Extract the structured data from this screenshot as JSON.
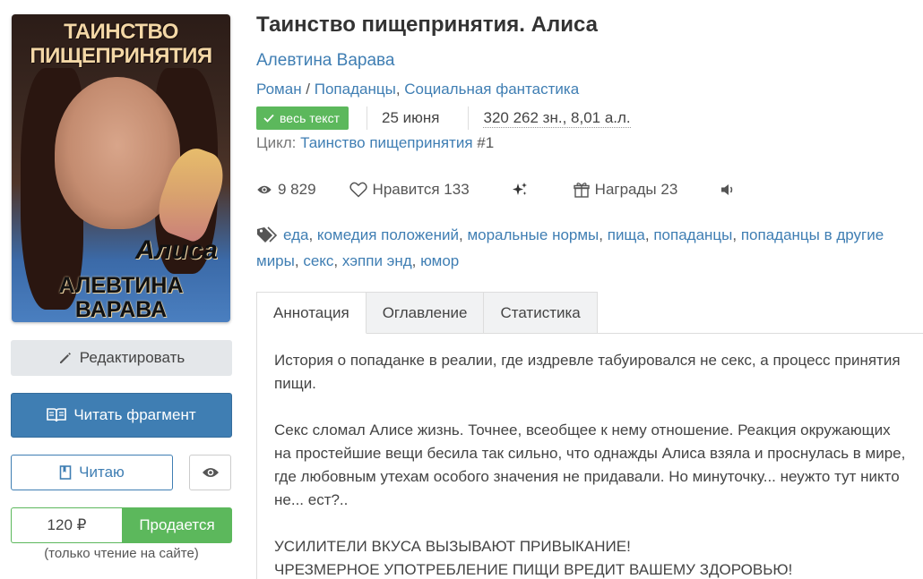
{
  "cover": {
    "title": "ТАИНСТВО ПИЩЕПРИНЯТИЯ",
    "series": "Алиса",
    "author": "АЛЕВТИНА ВАРАВА"
  },
  "actions": {
    "edit_label": "Редактировать",
    "read_fragment_label": "Читать фрагмент",
    "reading_label": "Читаю",
    "price": "120 ₽",
    "sale_label": "Продается",
    "price_note": "(только чтение на сайте)"
  },
  "book": {
    "title": "Таинство пищепринятия. Алиса",
    "author": "Алевтина Варава",
    "genres": [
      "Роман",
      "Попаданцы",
      "Социальная фантастика"
    ],
    "status_badge": "весь текст",
    "date": "25 июня",
    "size": "320 262 зн., 8,01 а.л.",
    "cycle_label": "Цикл:",
    "cycle_name": "Таинство пищепринятия",
    "cycle_num": "#1"
  },
  "stats": {
    "views": "9 829",
    "likes_label": "Нравится",
    "likes": "133",
    "awards_label": "Награды",
    "awards": "23"
  },
  "tags": [
    "еда",
    "комедия положений",
    "моральные нормы",
    "пища",
    "попаданцы",
    "попаданцы в другие миры",
    "секс",
    "хэппи энд",
    "юмор"
  ],
  "tabs": {
    "annotation": "Аннотация",
    "contents": "Оглавление",
    "statistics": "Статистика"
  },
  "annotation": {
    "p1": "История о попаданке в реалии, где издревле табуировался не секс, а процесс принятия пищи.",
    "p2": "Секс сломал Алисе жизнь. Точнее, всеобщее к нему отношение. Реакция окружающих на простейшие вещи бесила так сильно, что однажды Алиса взяла и проснулась в мире, где любовным утехам особого значения не придавали. Но минуточку... неужто тут никто не... ест?..",
    "p3": "УСИЛИТЕЛИ ВКУСА ВЫЗЫВАЮТ ПРИВЫКАНИЕ!",
    "p4": "ЧРЕЗМЕРНОЕ УПОТРЕБЛЕНИЕ ПИЩИ ВРЕДИТ ВАШЕМУ ЗДОРОВЬЮ!"
  }
}
